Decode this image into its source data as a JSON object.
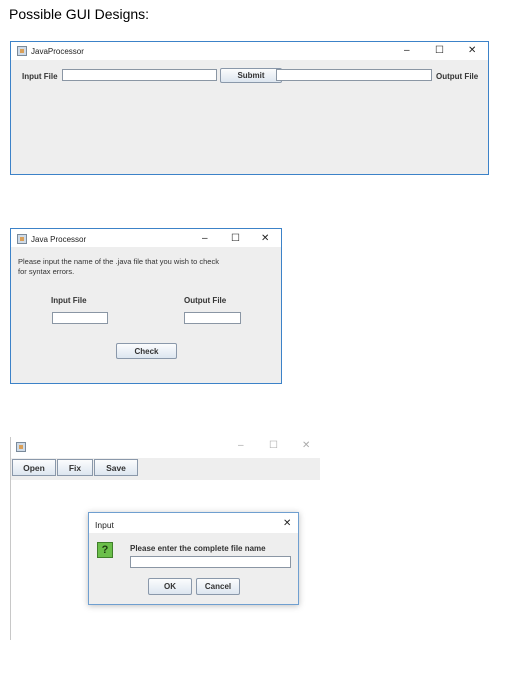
{
  "page": {
    "heading": "Possible GUI Designs:"
  },
  "design1": {
    "window_title": "JavaProcessor",
    "controls": {
      "minimize": "–",
      "maximize": "☐",
      "close": "✕"
    },
    "input_label": "Input File",
    "input_value": "",
    "submit_label": "Submit",
    "output_value": "",
    "output_label": "Output File"
  },
  "design2": {
    "window_title": "Java Processor",
    "controls": {
      "minimize": "–",
      "maximize": "☐",
      "close": "✕"
    },
    "message_line1": "Please input the name of the .java file that you wish to check",
    "message_line2": "for syntax errors.",
    "input_label": "Input File",
    "output_label": "Output File",
    "input_value": "",
    "output_value": "",
    "check_label": "Check"
  },
  "design3": {
    "window_title": "",
    "controls": {
      "minimize": "–",
      "maximize": "☐",
      "close": "✕"
    },
    "toolbar": {
      "open": "Open",
      "fix": "Fix",
      "save": "Save"
    },
    "dialog": {
      "title": "Input",
      "close": "✕",
      "icon_glyph": "?",
      "prompt": "Please enter the complete file name",
      "value": "",
      "ok_label": "OK",
      "cancel_label": "Cancel"
    }
  }
}
